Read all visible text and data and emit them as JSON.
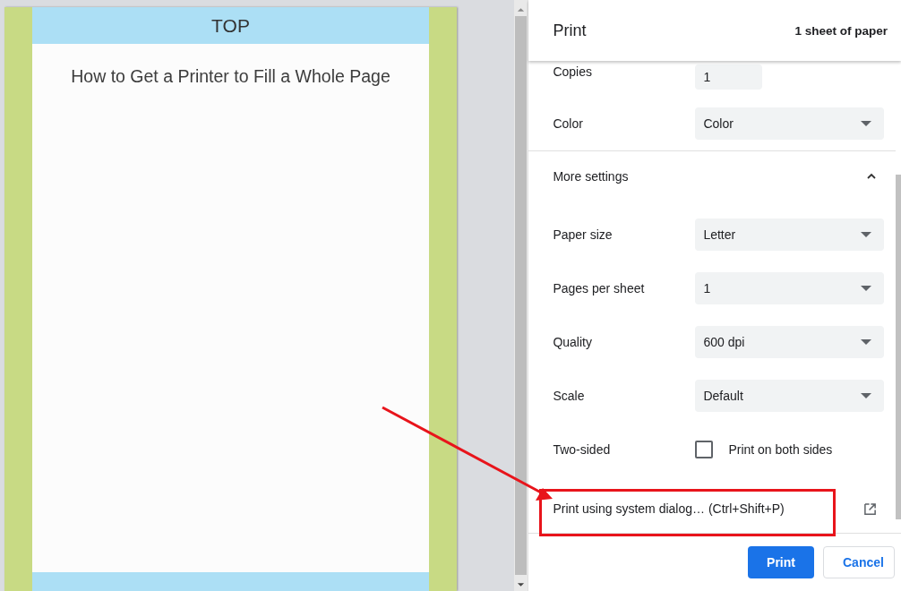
{
  "preview": {
    "top_band": "TOP",
    "title": "How to Get a Printer to Fill a Whole Page"
  },
  "panel": {
    "title": "Print",
    "sheet_count": "1 sheet of paper"
  },
  "settings": [
    {
      "kind": "input",
      "label": "Copies",
      "value": "1"
    },
    {
      "kind": "select",
      "label": "Color",
      "value": "Color"
    },
    {
      "kind": "section",
      "label": "More settings",
      "expanded": true
    },
    {
      "kind": "select",
      "label": "Paper size",
      "value": "Letter"
    },
    {
      "kind": "select",
      "label": "Pages per sheet",
      "value": "1"
    },
    {
      "kind": "select",
      "label": "Quality",
      "value": "600 dpi"
    },
    {
      "kind": "select",
      "label": "Scale",
      "value": "Default"
    },
    {
      "kind": "checkbox",
      "label": "Two-sided",
      "option": "Print on both sides",
      "checked": false
    },
    {
      "kind": "link",
      "label": "Print using system dialog… (Ctrl+Shift+P)"
    }
  ],
  "buttons": [
    {
      "kind": "primary",
      "label": "Print"
    },
    {
      "kind": "secondary",
      "label": "Cancel"
    }
  ]
}
